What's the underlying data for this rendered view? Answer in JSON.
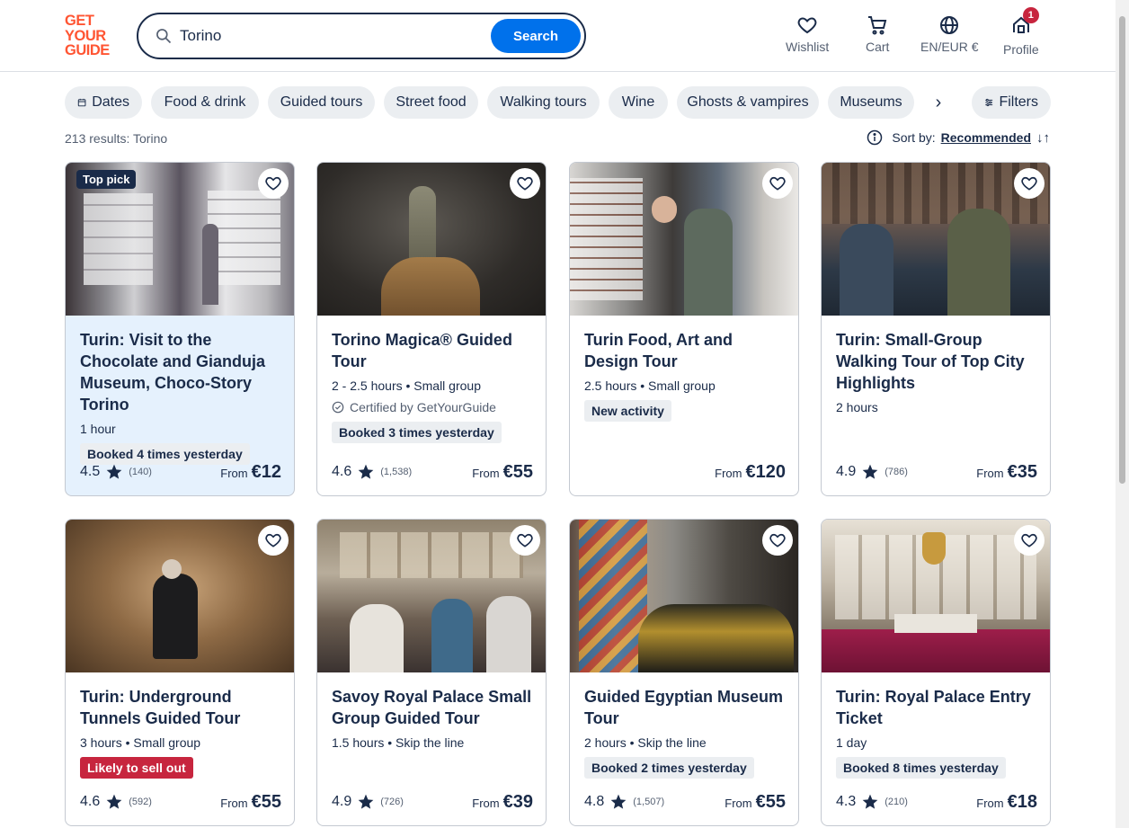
{
  "brand": {
    "logo_line1": "GET",
    "logo_line2": "YOUR",
    "logo_line3": "GUIDE",
    "color": "#ff5533"
  },
  "search": {
    "value": "Torino",
    "button_label": "Search",
    "accent": "#0071eb"
  },
  "nav": {
    "wishlist": "Wishlist",
    "cart": "Cart",
    "language": "EN/EUR €",
    "profile": "Profile",
    "profile_badge": "1"
  },
  "chips": [
    "Dates",
    "Food & drink",
    "Guided tours",
    "Street food",
    "Walking tours",
    "Wine",
    "Ghosts & vampires",
    "Museums"
  ],
  "filters_label": "Filters",
  "results": {
    "count_text": "213 results: Torino",
    "sort_label": "Sort by:",
    "sort_value": "Recommended"
  },
  "cards": [
    {
      "title": "Turin: Visit to the Chocolate and Gianduja Museum, Choco-Story Torino",
      "meta": "1 hour",
      "badge": "Booked 4 times yesterday",
      "top_pick": "Top pick",
      "rating": "4.5",
      "reviews": "(140)",
      "from": "From",
      "price": "€12"
    },
    {
      "title": "Torino Magica® Guided Tour",
      "meta": "2 - 2.5 hours • Small group",
      "certified": "Certified by GetYourGuide",
      "badge": "Booked 3 times yesterday",
      "rating": "4.6",
      "reviews": "(1,538)",
      "from": "From",
      "price": "€55"
    },
    {
      "title": "Turin Food, Art and Design Tour",
      "meta": "2.5 hours • Small group",
      "badge": "New activity",
      "from": "From",
      "price": "€120"
    },
    {
      "title": "Turin: Small-Group Walking Tour of Top City Highlights",
      "meta": "2 hours",
      "rating": "4.9",
      "reviews": "(786)",
      "from": "From",
      "price": "€35"
    },
    {
      "title": "Turin: Underground Tunnels Guided Tour",
      "meta": "3 hours • Small group",
      "badge_red": "Likely to sell out",
      "rating": "4.6",
      "reviews": "(592)",
      "from": "From",
      "price": "€55"
    },
    {
      "title": "Savoy Royal Palace Small Group Guided Tour",
      "meta": "1.5 hours • Skip the line",
      "rating": "4.9",
      "reviews": "(726)",
      "from": "From",
      "price": "€39"
    },
    {
      "title": "Guided Egyptian Museum Tour",
      "meta": "2 hours • Skip the line",
      "badge": "Booked 2 times yesterday",
      "rating": "4.8",
      "reviews": "(1,507)",
      "from": "From",
      "price": "€55"
    },
    {
      "title": "Turin: Royal Palace Entry Ticket",
      "meta": "1 day",
      "badge": "Booked 8 times yesterday",
      "rating": "4.3",
      "reviews": "(210)",
      "from": "From",
      "price": "€18"
    }
  ]
}
